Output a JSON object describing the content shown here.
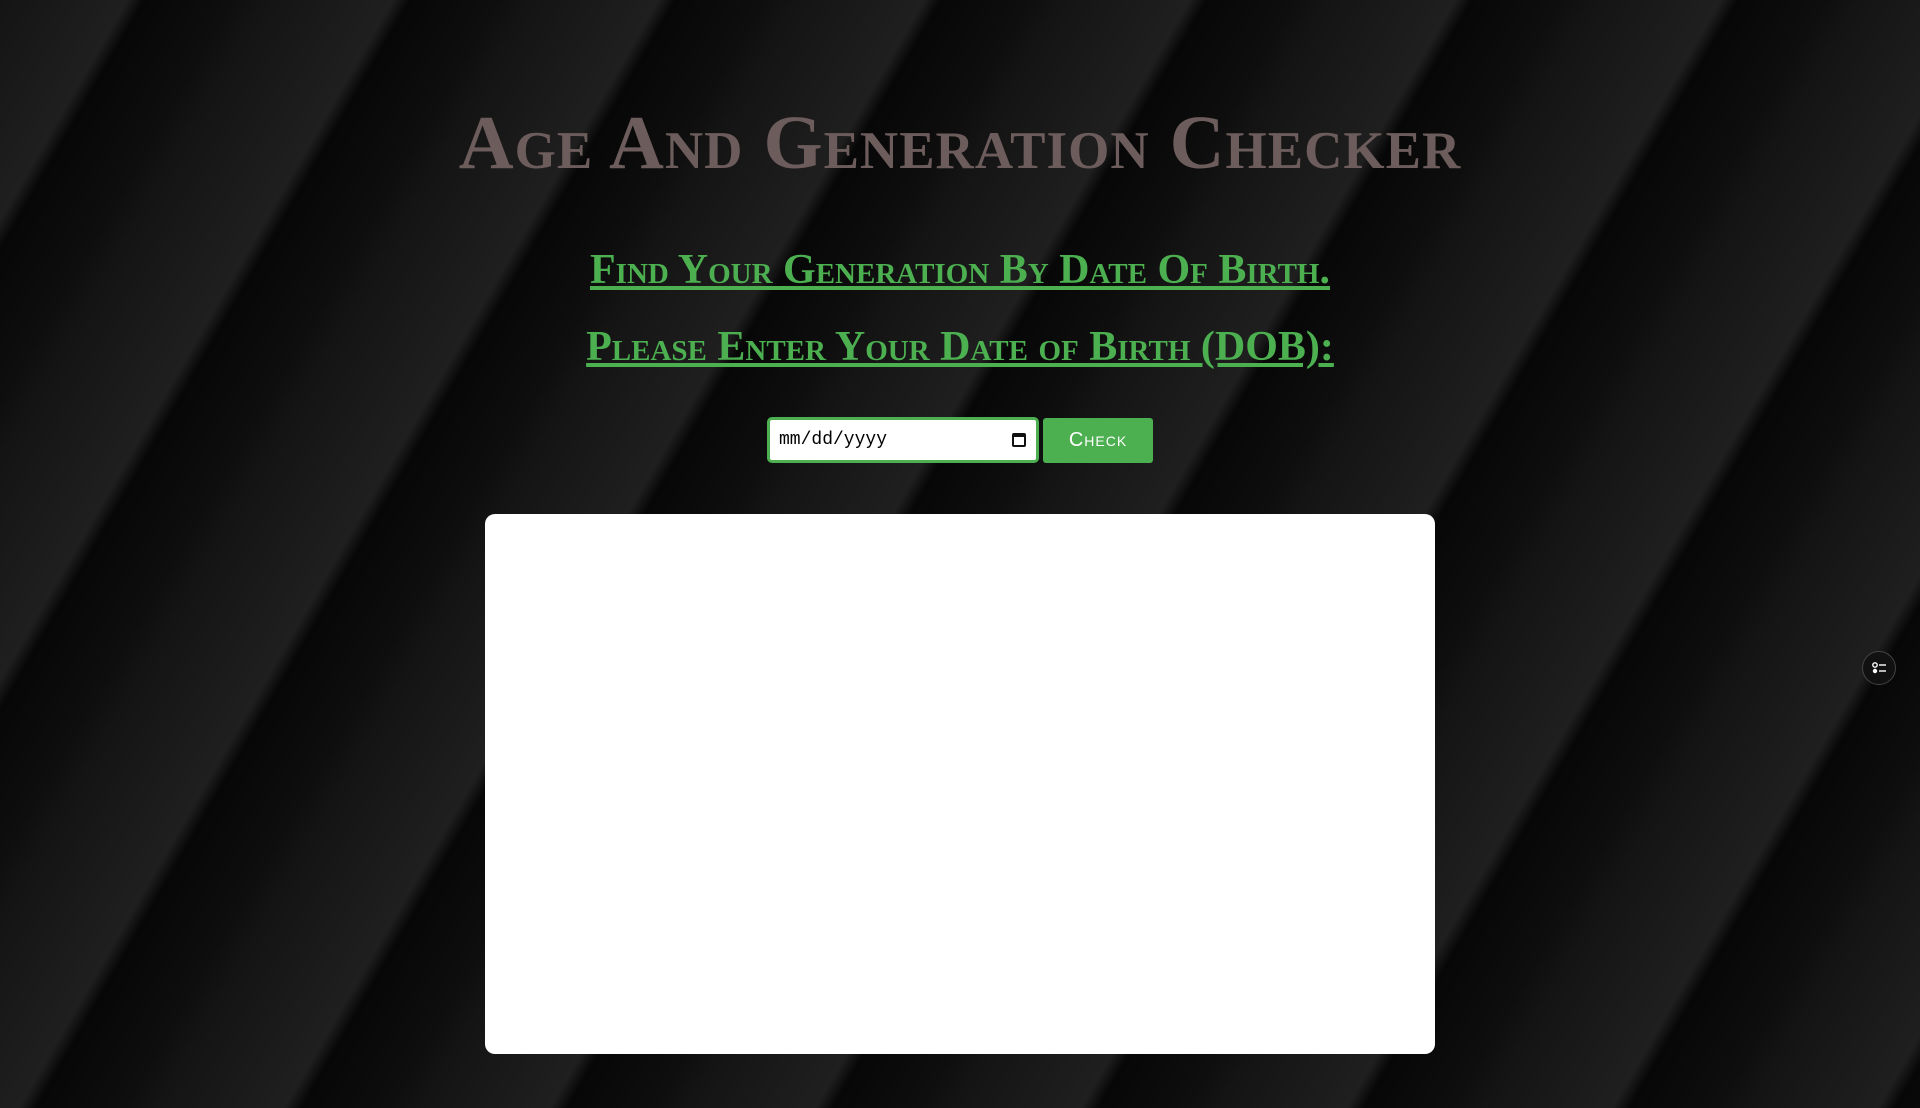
{
  "page": {
    "title": "Age And Generation Checker",
    "subtitle_find": "Find Your Generation By Date Of Birth.",
    "subtitle_enter": "Please Enter Your Date of Birth (DOB):"
  },
  "form": {
    "date_placeholder": "mm/dd/yyyy",
    "check_label": "Check"
  },
  "icons": {
    "date_picker": "calendar-icon",
    "side_widget": "settings-sliders-icon"
  },
  "colors": {
    "title": "#6d5c5c",
    "accent": "#4caf50",
    "panel": "#ffffff",
    "background": "#0b0b0b"
  }
}
